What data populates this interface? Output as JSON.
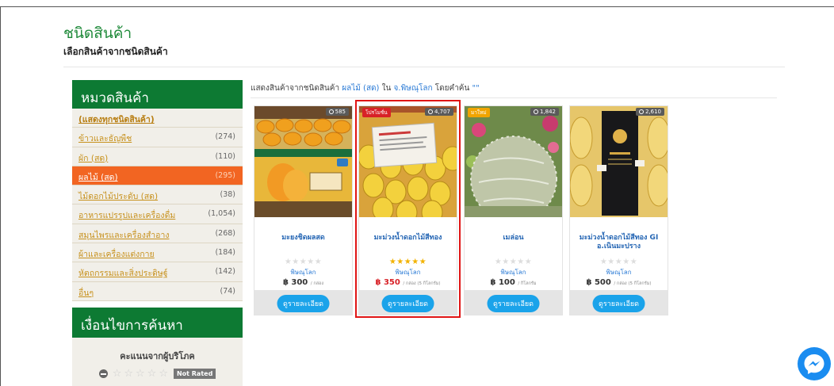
{
  "header": {
    "title": "ชนิดสินค้า",
    "subtitle": "เลือกสินค้าจากชนิดสินค้า"
  },
  "sidebar": {
    "category_title": "หมวดสินค้า",
    "categories": [
      {
        "label": "(แสดงทุกชนิดสินค้า)",
        "count": ""
      },
      {
        "label": "ข้าวและธัญพืช",
        "count": "(274)"
      },
      {
        "label": "ผัก (สด)",
        "count": "(110)"
      },
      {
        "label": "ผลไม้ (สด)",
        "count": "(295)"
      },
      {
        "label": "ไม้ดอกไม้ประดับ (สด)",
        "count": "(38)"
      },
      {
        "label": "อาหารแปรรูปและเครื่องดื่ม",
        "count": "(1,054)"
      },
      {
        "label": "สมุนไพรและเครื่องสำอาง",
        "count": "(268)"
      },
      {
        "label": "ผ้าและเครื่องแต่งกาย",
        "count": "(184)"
      },
      {
        "label": "หัตถกรรมและสิ่งประดิษฐ์",
        "count": "(142)"
      },
      {
        "label": "อื่นๆ",
        "count": "(74)"
      }
    ],
    "search_title": "เงื่อนไขการค้นหา",
    "rating_title": "คะแนนจากผู้บริโภค",
    "not_rated": "Not Rated"
  },
  "results": {
    "prefix": "แสดงสินค้าจากชนิดสินค้า",
    "category": "ผลไม้ (สด)",
    "in_word": "ใน",
    "province": "จ.พิษณุโลก",
    "keyword_label": "โดยคำค้น",
    "keyword": "\"\""
  },
  "products": [
    {
      "name": "มะยงชิดผลสด",
      "views": "585",
      "badge": "",
      "stars": "★★★★★",
      "location": "พิษณุโลก",
      "price": "฿ 300",
      "unit": "/ กล่อง",
      "button": "ดูรายละเอียด"
    },
    {
      "name": "มะม่วงน้ำดอกไม้สีทอง",
      "views": "4,707",
      "badge": "โปรโมชั่น",
      "stars": "★★★★★",
      "location": "พิษณุโลก",
      "price": "฿ 350",
      "unit": "/ กล่อง (5 กิโลกรัม)",
      "button": "ดูรายละเอียด"
    },
    {
      "name": "เมล่อน",
      "views": "1,842",
      "badge": "มาใหม่",
      "stars": "★★★★★",
      "location": "พิษณุโลก",
      "price": "฿ 100",
      "unit": "/ กิโลกรัม",
      "button": "ดูรายละเอียด"
    },
    {
      "name": "มะม่วงน้ำดอกไม้สีทอง GI อ.เนินมะปราง",
      "views": "2,610",
      "badge": "",
      "stars": "★★★★★",
      "location": "พิษณุโลก",
      "price": "฿ 500",
      "unit": "/ กล่อง (5 กิโลกรัม)",
      "button": "ดูรายละเอียด"
    }
  ],
  "colors": {
    "brand_green": "#0d7a33",
    "active_orange": "#f26522",
    "link_blue": "#2b7bd6",
    "button_blue": "#1aa3ea",
    "highlight_red": "#e01515"
  }
}
